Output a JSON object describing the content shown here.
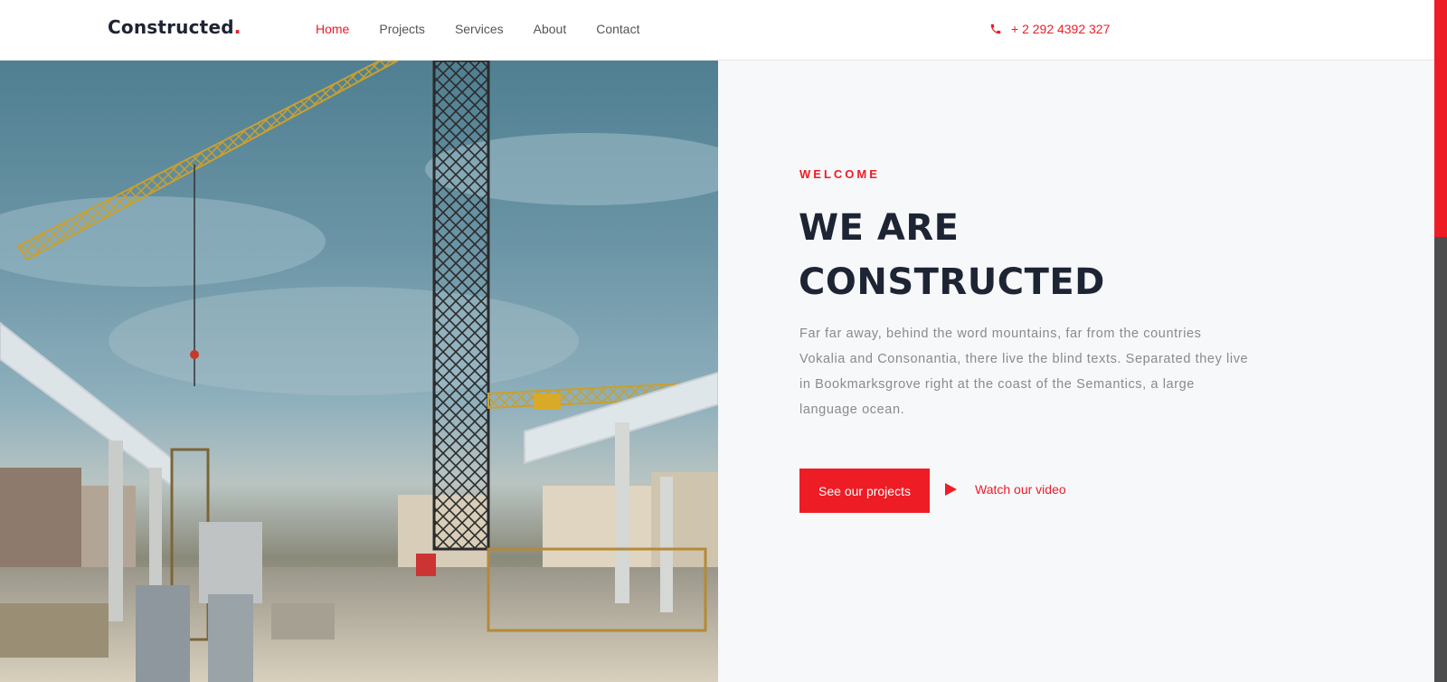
{
  "header": {
    "logo_text": "Constructed",
    "logo_dot": ".",
    "nav": [
      {
        "label": "Home",
        "active": true
      },
      {
        "label": "Projects",
        "active": false
      },
      {
        "label": "Services",
        "active": false
      },
      {
        "label": "About",
        "active": false
      },
      {
        "label": "Contact",
        "active": false
      }
    ],
    "phone": "+ 2 292 4392 327",
    "phone_icon": "phone-icon"
  },
  "hero": {
    "image_description": "construction site with cranes",
    "welcome": "WELCOME",
    "title_line1": "WE ARE",
    "title_line2": "CONSTRUCTED",
    "description": "Far far away, behind the word mountains, far from the countries Vokalia and Consonantia, there live the blind texts. Separated they live in Bookmarksgrove right at the coast of the Semantics, a large language ocean.",
    "primary_button": "See our projects",
    "video_link": "Watch our video",
    "video_icon": "play-icon"
  },
  "colors": {
    "accent": "#ee1c25",
    "dark": "#1d2433",
    "panel_bg": "#f7f8fa"
  }
}
